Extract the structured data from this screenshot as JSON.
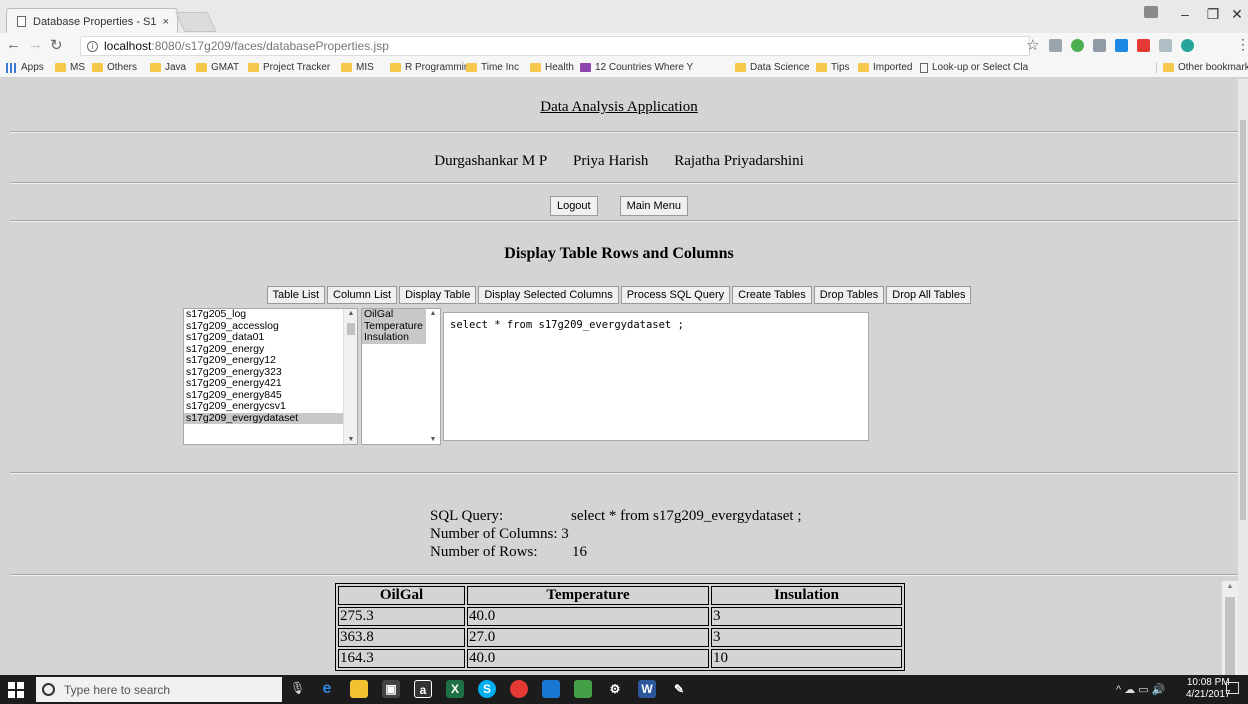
{
  "browser": {
    "tab_title": "Database Properties - S1",
    "tab_close": "×",
    "url_host": "localhost",
    "url_path": ":8080/s17g209/faces/databaseProperties.jsp",
    "bookmarks": [
      "Apps",
      "MS",
      "Others",
      "Java",
      "GMAT",
      "Project Tracker",
      "MIS",
      "R Programming",
      "Time Inc",
      "Health",
      "12 Countries Where Y",
      "Data Science",
      "Tips",
      "Imported",
      "Look-up or Select Cla"
    ],
    "other_bookmarks": "Other bookmarks"
  },
  "header": {
    "title": "Data Analysis Application",
    "authors": [
      "Durgashankar M P",
      "Priya Harish",
      "Rajatha Priyadarshini"
    ],
    "logout_label": "Logout",
    "main_menu_label": "Main Menu"
  },
  "section": {
    "title": "Display Table Rows and Columns",
    "toolbar": [
      "Table List",
      "Column List",
      "Display Table",
      "Display Selected Columns",
      "Process SQL Query",
      "Create Tables",
      "Drop Tables",
      "Drop All Tables"
    ]
  },
  "tables_list": {
    "items": [
      "s17g205_log",
      "s17g209_accesslog",
      "s17g209_data01",
      "s17g209_energy",
      "s17g209_energy12",
      "s17g209_energy323",
      "s17g209_energy421",
      "s17g209_energy845",
      "s17g209_energycsv1",
      "s17g209_evergydataset"
    ],
    "selected": "s17g209_evergydataset"
  },
  "columns_list": {
    "items": [
      "OilGal",
      "Temperature",
      "Insulation"
    ]
  },
  "sql_query_text": "select * from s17g209_evergydataset ;",
  "result_info": {
    "sql_label": "SQL Query:",
    "sql_value": "select * from s17g209_evergydataset ;",
    "columns_label": "Number of Columns:",
    "columns_value": "3",
    "rows_label": "Number of Rows:",
    "rows_value": "16"
  },
  "result_table": {
    "headers": [
      "OilGal",
      "Temperature",
      "Insulation"
    ],
    "rows": [
      [
        "275.3",
        "40.0",
        "3"
      ],
      [
        "363.8",
        "27.0",
        "3"
      ],
      [
        "164.3",
        "40.0",
        "10"
      ]
    ]
  },
  "taskbar": {
    "search_placeholder": "Type here to search",
    "time": "10:08 PM",
    "date": "4/21/2017"
  },
  "colors": {
    "page_bg": "#d4d4d4",
    "taskbar_bg": "#1c1c1c",
    "folder": "#f5c84c"
  }
}
